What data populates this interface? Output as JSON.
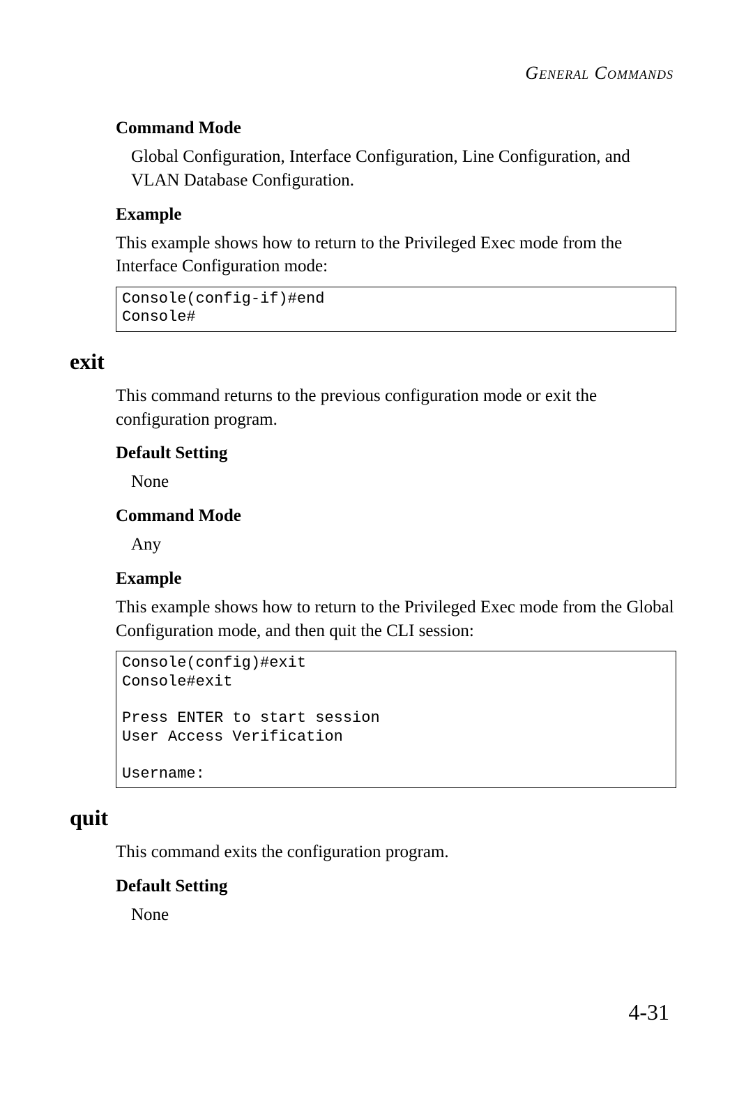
{
  "header": {
    "running_title": "General Commands"
  },
  "section_end": {
    "cmd_mode_label": "Command Mode",
    "cmd_mode_text": "Global Configuration, Interface Configuration, Line Configuration, and VLAN Database Configuration.",
    "example_label": "Example",
    "example_text": "This example shows how to return to the Privileged Exec mode from the Interface Configuration mode:",
    "code": "Console(config-if)#end\nConsole#"
  },
  "section_exit": {
    "title": "exit",
    "description": "This command returns to the previous configuration mode or exit the configuration program.",
    "default_label": "Default Setting",
    "default_text": "None",
    "cmd_mode_label": "Command Mode",
    "cmd_mode_text": "Any",
    "example_label": "Example",
    "example_text": "This example shows how to return to the Privileged Exec mode from the Global Configuration mode, and then quit the CLI session:",
    "code": "Console(config)#exit\nConsole#exit\n\nPress ENTER to start session\nUser Access Verification\n\nUsername:"
  },
  "section_quit": {
    "title": "quit",
    "description": "This command exits the configuration program.",
    "default_label": "Default Setting",
    "default_text": "None"
  },
  "page_number": "4-31"
}
